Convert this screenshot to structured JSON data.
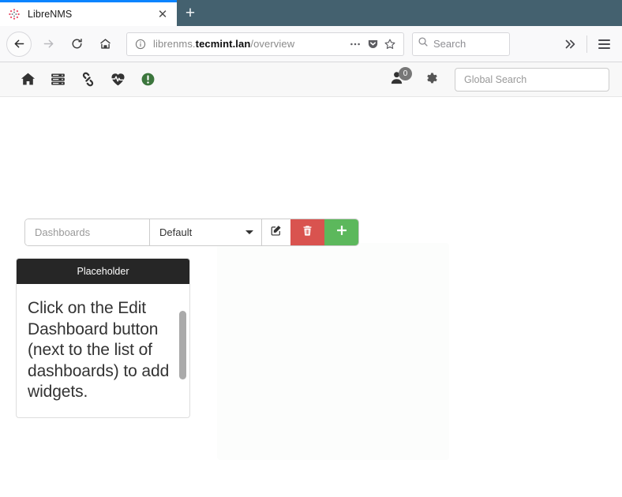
{
  "browser": {
    "tab": {
      "title": "LibreNMS",
      "favicon": "librenms-favicon-icon",
      "close_label": "✕"
    },
    "new_tab_label": "+",
    "nav": {
      "back": "back-arrow-icon",
      "forward": "forward-arrow-icon",
      "reload": "reload-icon",
      "home": "home-icon"
    },
    "urlbar": {
      "identity_icon": "info-circle-icon",
      "url_prefix": "librenms.",
      "url_host": "tecmint.lan",
      "url_path": "/overview",
      "page_actions_icon": "ellipsis-icon",
      "pocket_icon": "pocket-icon",
      "bookmark_icon": "star-icon"
    },
    "search": {
      "placeholder": "Search",
      "icon": "search-icon"
    },
    "overflow_icon": "double-chevron-right-icon",
    "menu_icon": "hamburger-menu-icon"
  },
  "app": {
    "navbar": {
      "links": [
        {
          "name": "home",
          "icon": "home-icon"
        },
        {
          "name": "devices",
          "icon": "server-stack-icon"
        },
        {
          "name": "ports",
          "icon": "link-chain-icon"
        },
        {
          "name": "health",
          "icon": "heartbeat-heart-icon"
        },
        {
          "name": "alerts",
          "icon": "exclamation-circle-icon"
        }
      ],
      "user": {
        "icon": "user-icon",
        "badge_count": "0"
      },
      "settings_icon": "gear-icon",
      "global_search_placeholder": "Global Search"
    },
    "dashboard_toolbar": {
      "dashboards_placeholder": "Dashboards",
      "selected_dashboard": "Default",
      "dropdown_options": [
        "Default"
      ],
      "edit_icon": "pencil-square-icon",
      "delete_icon": "trash-icon",
      "add_icon": "plus-icon",
      "edit_title": "Edit Dashboard",
      "delete_title": "Delete Dashboard",
      "add_title": "New Dashboard"
    },
    "widget": {
      "header": "Placeholder",
      "body_text": "Click on the Edit Dashboard button (next to the list of dashboards) to add widgets."
    }
  },
  "colors": {
    "tab_bar": "#44616f",
    "tab_active_accent": "#0a84ff",
    "navbar_bg": "#f8f8f8",
    "widget_header_bg": "#262626",
    "danger": "#d9534f",
    "success": "#5cb85c",
    "badge": "#777777",
    "alert_green": "#3c763d"
  }
}
